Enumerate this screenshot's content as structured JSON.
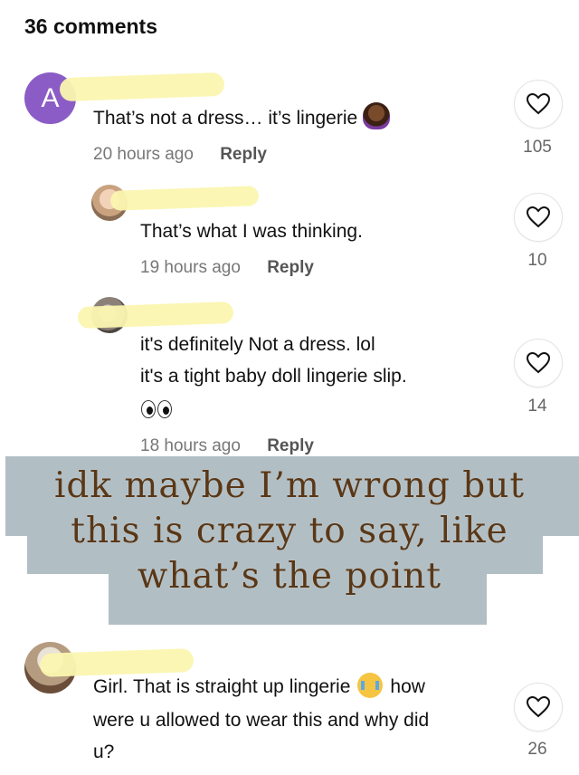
{
  "header": {
    "title": "36 comments"
  },
  "comments": [
    {
      "avatar_letter": "A",
      "text": "That’s not a dress… it’s lingerie",
      "emoji": "woman-gesturing-no-emoji",
      "time": "20 hours ago",
      "reply_label": "Reply",
      "likes": "105"
    },
    {
      "text": "That’s what I was thinking.",
      "time": "19 hours ago",
      "reply_label": "Reply",
      "likes": "10"
    },
    {
      "text_line1": "it's definitely Not a dress. lol",
      "text_line2": "it's a tight baby doll lingerie slip.",
      "emoji": "eyes-emoji",
      "time": "18 hours ago",
      "reply_label": "Reply",
      "likes": "14"
    },
    {
      "text_line1a": "Girl. That is straight up lingerie",
      "emoji": "crying-face-emoji",
      "text_line1b": "how",
      "text_line2": "were u allowed to wear this and why did",
      "text_line3": "u?",
      "likes": "26"
    }
  ],
  "overlay": {
    "line1": "idk maybe I’m wrong but",
    "line2": "this is crazy to say, like",
    "line3": "what’s the point"
  },
  "colors": {
    "avatar_purple": "#8b5cc6",
    "redaction_yellow": "#fbf5b0",
    "overlay_bg": "#aebdc3",
    "overlay_text": "#5a3716"
  }
}
